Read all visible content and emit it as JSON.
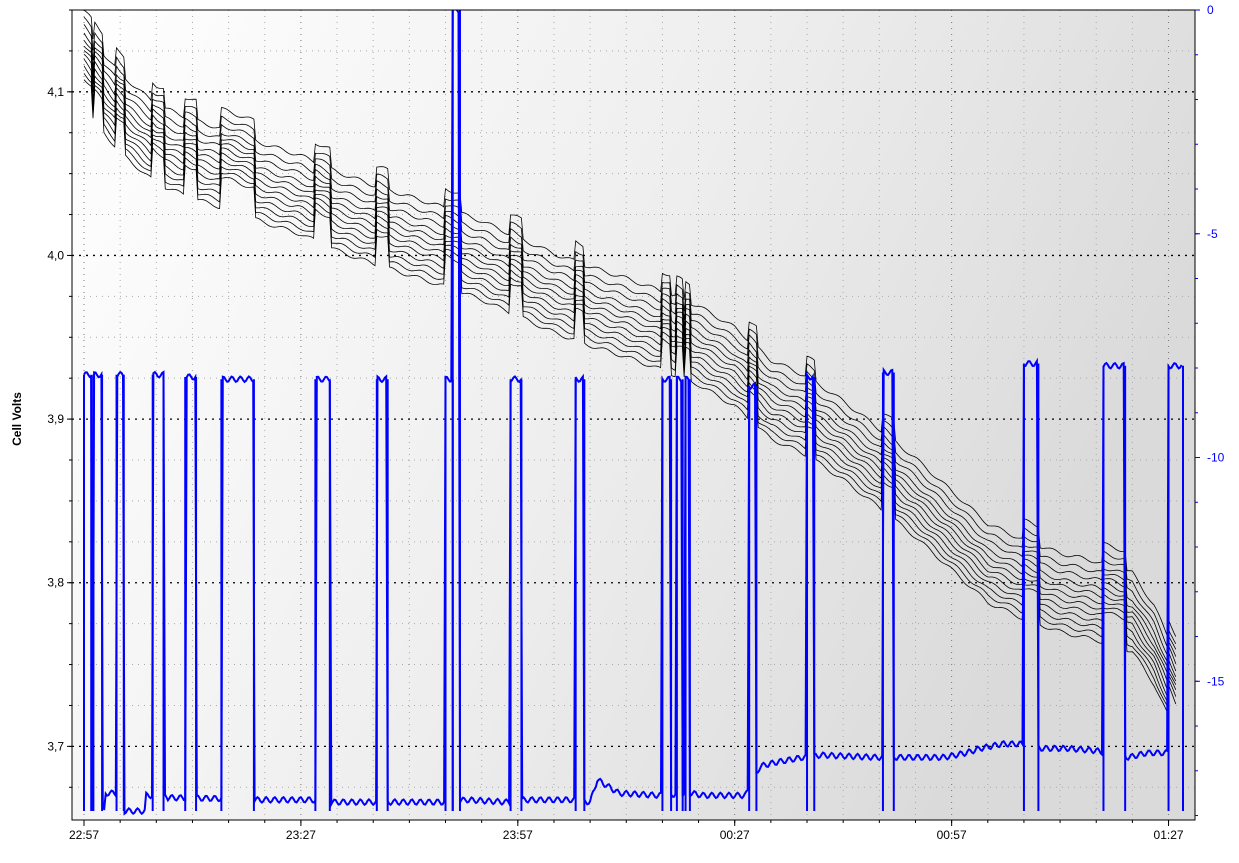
{
  "chart_data": {
    "type": "line",
    "ylabel": "Cell Volts",
    "xlabel": "",
    "x_ticks": [
      "22:57",
      "23:27",
      "23:57",
      "00:27",
      "00:57",
      "01:27"
    ],
    "x_range_minutes": [
      0,
      152
    ],
    "ylim": [
      3.655,
      4.15
    ],
    "y_ticks": [
      "3,7",
      "3,8",
      "3,9",
      "4,0",
      "4,1"
    ],
    "y_tick_values": [
      3.7,
      3.8,
      3.9,
      4.0,
      4.1
    ],
    "y2lim": [
      -18.1,
      0
    ],
    "y2_ticks": [
      "0",
      "-5",
      "-10",
      "-15"
    ],
    "y2_tick_values": [
      0,
      -5,
      -10,
      -15
    ],
    "grid": true,
    "colors": {
      "cells": "#000000",
      "current": "#0000ff",
      "right_axis": "#0000ff"
    },
    "series": [
      {
        "axis": "left",
        "description_color": "#000000",
        "cell_offsets": [
          0.026,
          0.02,
          0.015,
          0.01,
          0.006,
          0.002,
          -0.002,
          -0.006,
          -0.01,
          -0.014,
          -0.018,
          -0.022
        ],
        "points": [
          [
            0,
            4.112
          ],
          [
            5,
            4.085
          ],
          [
            10,
            4.066
          ],
          [
            15,
            4.057
          ],
          [
            20,
            4.05
          ],
          [
            25,
            4.042
          ],
          [
            30,
            4.035
          ],
          [
            35,
            4.025
          ],
          [
            40,
            4.017
          ],
          [
            45,
            4.01
          ],
          [
            50,
            4.003
          ],
          [
            55,
            3.995
          ],
          [
            60,
            3.985
          ],
          [
            65,
            3.975
          ],
          [
            70,
            3.967
          ],
          [
            75,
            3.96
          ],
          [
            80,
            3.952
          ],
          [
            85,
            3.943
          ],
          [
            90,
            3.93
          ],
          [
            95,
            3.91
          ],
          [
            100,
            3.9
          ],
          [
            105,
            3.885
          ],
          [
            110,
            3.868
          ],
          [
            115,
            3.85
          ],
          [
            120,
            3.83
          ],
          [
            125,
            3.81
          ],
          [
            130,
            3.8
          ],
          [
            135,
            3.792
          ],
          [
            140,
            3.787
          ],
          [
            145,
            3.78
          ],
          [
            148,
            3.76
          ],
          [
            151,
            3.73
          ]
        ]
      },
      {
        "axis": "right",
        "description_color": "#0000ff",
        "rest_level": -17.9,
        "segments": [
          [
            0,
            1.0,
            -8.15,
            1
          ],
          [
            1.3,
            2.5,
            -8.15,
            1
          ],
          [
            4.5,
            5.5,
            -8.15,
            1
          ],
          [
            9.5,
            11.0,
            -8.15,
            1
          ],
          [
            14.0,
            15.5,
            -8.2,
            1
          ],
          [
            19.0,
            23.5,
            -8.25,
            1
          ],
          [
            32.0,
            34.0,
            -8.25,
            1
          ],
          [
            40.5,
            42.0,
            -8.25,
            1
          ],
          [
            50.0,
            51.0,
            -8.25,
            1
          ],
          [
            51.0,
            52.0,
            0,
            1
          ],
          [
            59.0,
            60.5,
            -8.25,
            1
          ],
          [
            68.0,
            69.2,
            -8.25,
            1
          ],
          [
            80.0,
            81.2,
            -8.25,
            1
          ],
          [
            82.0,
            82.8,
            -8.25,
            1
          ],
          [
            83.2,
            83.8,
            -8.25,
            1
          ],
          [
            92.0,
            93.0,
            -8.4,
            1
          ],
          [
            100.0,
            101.0,
            -8.2,
            1
          ],
          [
            110.5,
            112.0,
            -8.1,
            1
          ],
          [
            130.0,
            132.0,
            -7.9,
            1
          ],
          [
            141.0,
            144.0,
            -7.95,
            1
          ],
          [
            150.0,
            152.0,
            -7.95,
            1
          ]
        ],
        "base": [
          [
            0,
            -17.9
          ],
          [
            3.0,
            -17.9
          ],
          [
            3.0,
            -17.5
          ],
          [
            5.5,
            -17.5
          ],
          [
            5.5,
            -17.9
          ],
          [
            8.5,
            -17.9
          ],
          [
            8.5,
            -17.55
          ],
          [
            11.5,
            -17.55
          ],
          [
            11.5,
            -17.6
          ],
          [
            18.5,
            -17.62
          ],
          [
            23.5,
            -17.65
          ],
          [
            31.5,
            -17.65
          ],
          [
            34.0,
            -17.7
          ],
          [
            40.0,
            -17.7
          ],
          [
            42.0,
            -17.7
          ],
          [
            49.5,
            -17.7
          ],
          [
            53.0,
            -17.65
          ],
          [
            58.5,
            -17.7
          ],
          [
            61.0,
            -17.65
          ],
          [
            67.5,
            -17.65
          ],
          [
            70.0,
            -17.7
          ],
          [
            71.0,
            -17.2
          ],
          [
            74.0,
            -17.5
          ],
          [
            79.5,
            -17.55
          ],
          [
            84.0,
            -17.5
          ],
          [
            85.5,
            -17.55
          ],
          [
            91.5,
            -17.55
          ],
          [
            93.5,
            -16.9
          ],
          [
            96.0,
            -16.8
          ],
          [
            99.5,
            -16.7
          ],
          [
            102.0,
            -16.65
          ],
          [
            109.5,
            -16.7
          ],
          [
            112.5,
            -16.7
          ],
          [
            119.0,
            -16.7
          ],
          [
            122.0,
            -16.6
          ],
          [
            124.0,
            -16.5
          ],
          [
            127.0,
            -16.4
          ],
          [
            129.5,
            -16.4
          ],
          [
            132.5,
            -16.5
          ],
          [
            136.0,
            -16.5
          ],
          [
            140.0,
            -16.55
          ],
          [
            144.5,
            -16.7
          ],
          [
            147.0,
            -16.6
          ],
          [
            149.5,
            -16.6
          ]
        ]
      }
    ]
  }
}
